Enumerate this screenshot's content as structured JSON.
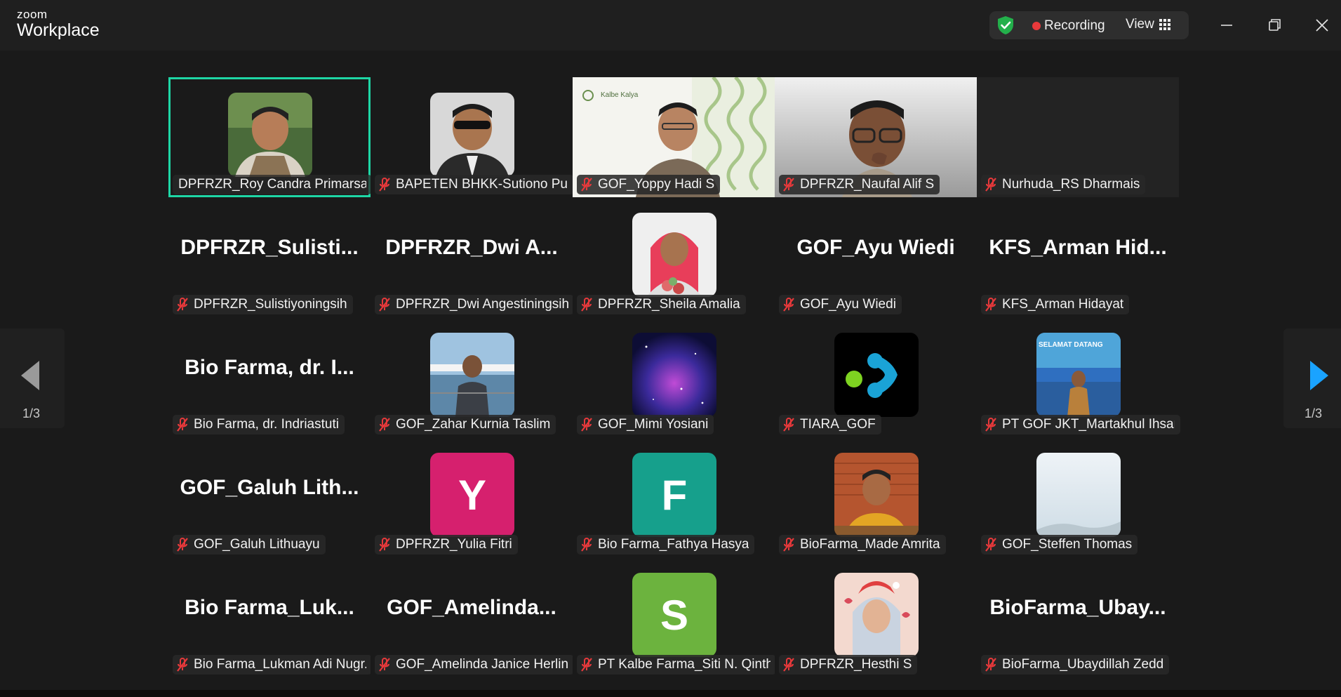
{
  "app": {
    "brand_small": "zoom",
    "brand_large": "Workplace"
  },
  "titlebar": {
    "recording_label": "Recording",
    "view_label": "View"
  },
  "colors": {
    "active_speaker_border": "#1ed6a5",
    "recording_dot": "#e8393b",
    "shield": "#23b04b",
    "muted_mic": "#e8393b",
    "pager_arrow_active": "#1aa3ff"
  },
  "pager": {
    "left_page": "1/3",
    "right_page": "1/3"
  },
  "participants": [
    {
      "name": "DPFRZR_Roy Candra Primarsa",
      "tile": "photo",
      "active": true,
      "muted": false
    },
    {
      "name": "BAPETEN BHKK-Sutiono Pur...",
      "tile": "photo",
      "muted": true
    },
    {
      "name": "GOF_Yoppy Hadi S",
      "tile": "video",
      "muted": true,
      "overlay_text": "Kalbe Kalya"
    },
    {
      "name": "DPFRZR_Naufal Alif S",
      "tile": "video",
      "muted": true
    },
    {
      "name": "Nurhuda_RS Dharmais",
      "tile": "blank",
      "muted": true
    },
    {
      "name": "DPFRZR_Sulistiyoningsih",
      "tile": "name",
      "big_name": "DPFRZR_Sulisti...",
      "muted": true
    },
    {
      "name": "DPFRZR_Dwi Angestiningsih",
      "tile": "name",
      "big_name": "DPFRZR_Dwi  A...",
      "muted": true
    },
    {
      "name": "DPFRZR_Sheila Amalia",
      "tile": "photo",
      "muted": true
    },
    {
      "name": "GOF_Ayu Wiedi",
      "tile": "name",
      "big_name": "GOF_Ayu Wiedi",
      "muted": true
    },
    {
      "name": "KFS_Arman Hidayat",
      "tile": "name",
      "big_name": "KFS_Arman  Hid...",
      "muted": true
    },
    {
      "name": "Bio Farma, dr. Indriastuti",
      "tile": "name",
      "big_name": "Bio  Farma,  dr.  I...",
      "muted": true
    },
    {
      "name": "GOF_Zahar Kurnia Taslim",
      "tile": "photo",
      "muted": true
    },
    {
      "name": "GOF_Mimi Yosiani",
      "tile": "photo",
      "muted": true
    },
    {
      "name": "TIARA_GOF",
      "tile": "logo",
      "muted": true
    },
    {
      "name": "PT GOF JKT_Martakhul Ihsan...",
      "tile": "photo",
      "muted": true,
      "overlay_text": "SELAMAT DATANG"
    },
    {
      "name": "GOF_Galuh Lithuayu",
      "tile": "name",
      "big_name": "GOF_Galuh  Lith...",
      "muted": true
    },
    {
      "name": "DPFRZR_Yulia Fitri",
      "tile": "letter",
      "letter": "Y",
      "color": "#d6206e",
      "muted": true
    },
    {
      "name": "Bio Farma_Fathya Hasya",
      "tile": "letter",
      "letter": "F",
      "color": "#16a08c",
      "muted": true
    },
    {
      "name": "BioFarma_Made Amrita",
      "tile": "photo",
      "muted": true
    },
    {
      "name": "GOF_Steffen Thomas",
      "tile": "photo",
      "muted": true
    },
    {
      "name": "Bio Farma_Lukman Adi Nugr...",
      "tile": "name",
      "big_name": "Bio  Farma_Luk...",
      "muted": true
    },
    {
      "name": "GOF_Amelinda Janice Herlina",
      "tile": "name",
      "big_name": "GOF_Amelinda...",
      "muted": true
    },
    {
      "name": "PT Kalbe Farma_Siti N. Qinth...",
      "tile": "letter",
      "letter": "S",
      "color": "#6cb33e",
      "muted": true
    },
    {
      "name": "DPFRZR_Hesthi S",
      "tile": "photo",
      "muted": true
    },
    {
      "name": "BioFarma_Ubaydillah Zedd",
      "tile": "name",
      "big_name": "BioFarma_Ubay...",
      "muted": true
    }
  ]
}
